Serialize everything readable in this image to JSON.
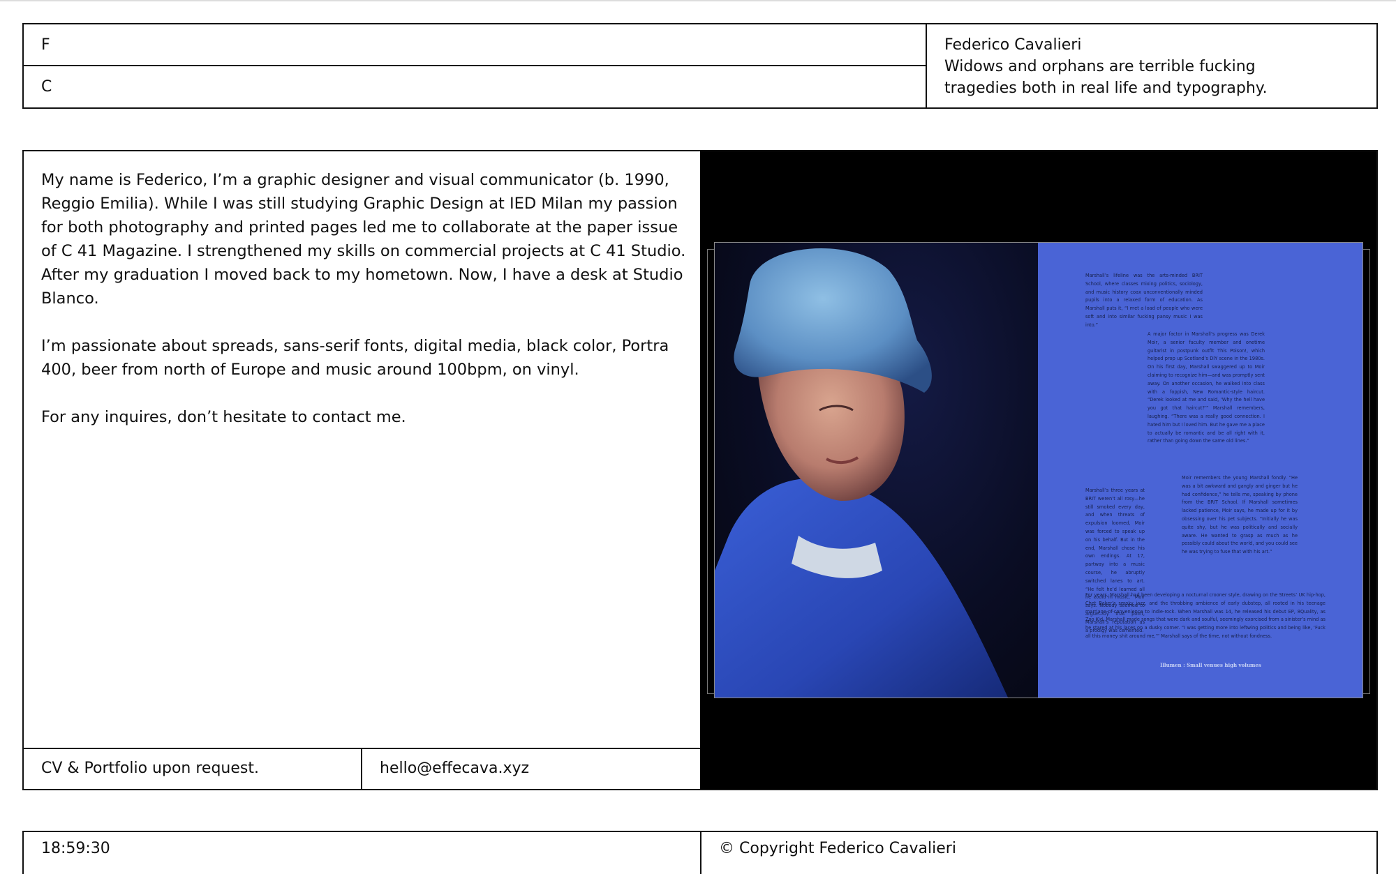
{
  "header": {
    "initial_f": "F",
    "initial_c": "C",
    "name": "Federico Cavalieri",
    "quote": "Widows and orphans are terrible fucking tragedies both in real life and typography."
  },
  "about": {
    "paragraphs": [
      "My name is Federico, I’m a graphic designer and visual communicator (b. 1990, Reggio Emilia). While I was still studying Graphic Design at IED Milan my passion for both photography and printed pages led me to collaborate at the paper issue of C 41 Magazine. I strengthened my skills on commercial projects at C 41 Studio. After my graduation I moved back to my hometown. Now, I have a desk at Studio Blanco.",
      "I’m passionate about spreads, sans-serif fonts, digital media, black color, Portra 400, beer from north of Europe and music around 100bpm, on vinyl.",
      "For any inquires, don’t hesitate to contact me."
    ],
    "cv_note": "CV & Portfolio upon request.",
    "email": "hello@effecava.xyz"
  },
  "spread": {
    "col1": "Marshall’s lifeline was the arts-minded BRIT School, where classes mixing politics, sociology, and music history coax unconventionally minded pupils into a relaxed form of education. As Marshall puts it, “I met a load of people who were soft and into similar fucking pansy music I was into.”",
    "col2": "A major factor in Marshall’s progress was Derek Moir, a senior faculty member and onetime guitarist in postpunk outfit This Poison!, which helped prop up Scotland’s DIY scene in the 1980s. On his first day, Marshall swaggered up to Moir claiming to recognize him—and was promptly sent away. On another occasion, he walked into class with a foppish, New Romantic-style haircut. “Derek looked at me and said, ‘Why the hell have you got that haircut?’” Marshall remembers, laughing. “There was a really good connection. I hated him but I loved him. But he gave me a place to actually be romantic and be all right with it, rather than going down the same old lines.”",
    "col3": "Marshall’s three years at BRIT weren’t all rosy—he still smoked every day, and when threats of expulsion loomed, Moir was forced to speak up on his behalf. But in the end, Marshall chose his own endings. At 17, partway into a music course, he abruptly switched lanes to art. “He felt he’d learned all he could in music,” Moir says. Nobody seemed to argue—by that point, Marshall’s reputation as a prodigy was cemented.",
    "col4": "Moir remembers the young Marshall fondly. “He was a bit awkward and gangly and ginger but he had confidence,” he tells me, speaking by phone from the BRIT School. If Marshall sometimes lacked patience, Moir says, he made up for it by obsessing over his pet subjects. “Initially he was quite shy, but he was politically and socially aware. He wanted to grasp as much as he possibly could about the world, and you could see he was trying to fuse that with his art.”",
    "col5": "For years, Marshall had been developing a nocturnal crooner style, drawing on the Streets’ UK hip-hop, Chet Baker’s smoky jazz, and the throbbing ambience of early dubstep, all rooted in his teenage marriage-of-convenience to indie-rock. When Marshall was 14, he released his debut EP, 8Quality, as Zoo Kid. Marshall made songs that were dark and soulful, seemingly exorcised from a sinister’s mind as he stared at his laces on a dusky corner. “I was getting more into leftwing politics and being like, ‘Fuck all this money shit around me,’” Marshall says of the time, not without fondness.",
    "caption": "Illumen : Small venues high volumes"
  },
  "footer": {
    "time": "18:59:30",
    "copyright": "© Copyright Federico Cavalieri"
  },
  "colors": {
    "page_background": "#ffffff",
    "border": "#111111",
    "media_background": "#000000",
    "spread_blue": "#4a64d6"
  }
}
